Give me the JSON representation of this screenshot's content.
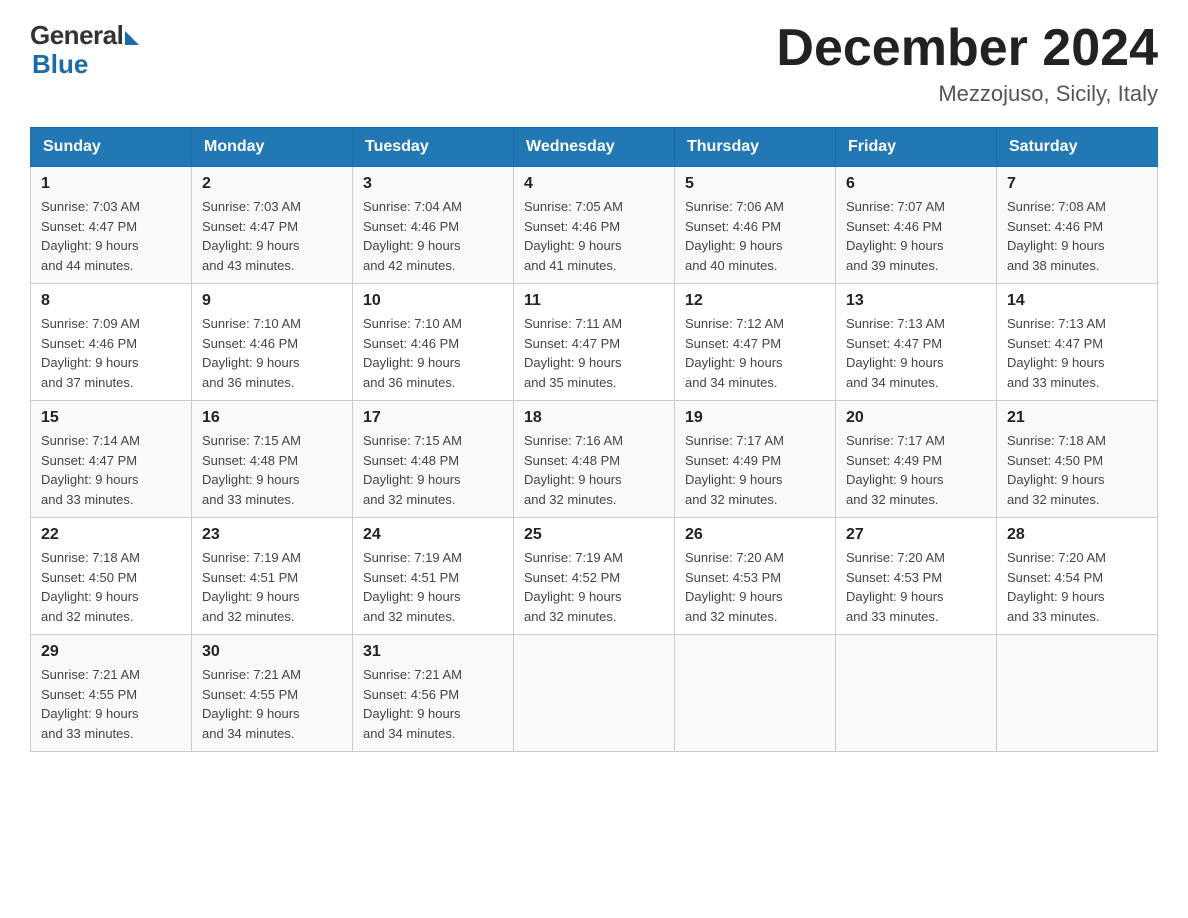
{
  "logo": {
    "general": "General",
    "blue": "Blue"
  },
  "header": {
    "title": "December 2024",
    "location": "Mezzojuso, Sicily, Italy"
  },
  "weekdays": [
    "Sunday",
    "Monday",
    "Tuesday",
    "Wednesday",
    "Thursday",
    "Friday",
    "Saturday"
  ],
  "weeks": [
    [
      {
        "day": "1",
        "sunrise": "7:03 AM",
        "sunset": "4:47 PM",
        "daylight": "9 hours and 44 minutes."
      },
      {
        "day": "2",
        "sunrise": "7:03 AM",
        "sunset": "4:47 PM",
        "daylight": "9 hours and 43 minutes."
      },
      {
        "day": "3",
        "sunrise": "7:04 AM",
        "sunset": "4:46 PM",
        "daylight": "9 hours and 42 minutes."
      },
      {
        "day": "4",
        "sunrise": "7:05 AM",
        "sunset": "4:46 PM",
        "daylight": "9 hours and 41 minutes."
      },
      {
        "day": "5",
        "sunrise": "7:06 AM",
        "sunset": "4:46 PM",
        "daylight": "9 hours and 40 minutes."
      },
      {
        "day": "6",
        "sunrise": "7:07 AM",
        "sunset": "4:46 PM",
        "daylight": "9 hours and 39 minutes."
      },
      {
        "day": "7",
        "sunrise": "7:08 AM",
        "sunset": "4:46 PM",
        "daylight": "9 hours and 38 minutes."
      }
    ],
    [
      {
        "day": "8",
        "sunrise": "7:09 AM",
        "sunset": "4:46 PM",
        "daylight": "9 hours and 37 minutes."
      },
      {
        "day": "9",
        "sunrise": "7:10 AM",
        "sunset": "4:46 PM",
        "daylight": "9 hours and 36 minutes."
      },
      {
        "day": "10",
        "sunrise": "7:10 AM",
        "sunset": "4:46 PM",
        "daylight": "9 hours and 36 minutes."
      },
      {
        "day": "11",
        "sunrise": "7:11 AM",
        "sunset": "4:47 PM",
        "daylight": "9 hours and 35 minutes."
      },
      {
        "day": "12",
        "sunrise": "7:12 AM",
        "sunset": "4:47 PM",
        "daylight": "9 hours and 34 minutes."
      },
      {
        "day": "13",
        "sunrise": "7:13 AM",
        "sunset": "4:47 PM",
        "daylight": "9 hours and 34 minutes."
      },
      {
        "day": "14",
        "sunrise": "7:13 AM",
        "sunset": "4:47 PM",
        "daylight": "9 hours and 33 minutes."
      }
    ],
    [
      {
        "day": "15",
        "sunrise": "7:14 AM",
        "sunset": "4:47 PM",
        "daylight": "9 hours and 33 minutes."
      },
      {
        "day": "16",
        "sunrise": "7:15 AM",
        "sunset": "4:48 PM",
        "daylight": "9 hours and 33 minutes."
      },
      {
        "day": "17",
        "sunrise": "7:15 AM",
        "sunset": "4:48 PM",
        "daylight": "9 hours and 32 minutes."
      },
      {
        "day": "18",
        "sunrise": "7:16 AM",
        "sunset": "4:48 PM",
        "daylight": "9 hours and 32 minutes."
      },
      {
        "day": "19",
        "sunrise": "7:17 AM",
        "sunset": "4:49 PM",
        "daylight": "9 hours and 32 minutes."
      },
      {
        "day": "20",
        "sunrise": "7:17 AM",
        "sunset": "4:49 PM",
        "daylight": "9 hours and 32 minutes."
      },
      {
        "day": "21",
        "sunrise": "7:18 AM",
        "sunset": "4:50 PM",
        "daylight": "9 hours and 32 minutes."
      }
    ],
    [
      {
        "day": "22",
        "sunrise": "7:18 AM",
        "sunset": "4:50 PM",
        "daylight": "9 hours and 32 minutes."
      },
      {
        "day": "23",
        "sunrise": "7:19 AM",
        "sunset": "4:51 PM",
        "daylight": "9 hours and 32 minutes."
      },
      {
        "day": "24",
        "sunrise": "7:19 AM",
        "sunset": "4:51 PM",
        "daylight": "9 hours and 32 minutes."
      },
      {
        "day": "25",
        "sunrise": "7:19 AM",
        "sunset": "4:52 PM",
        "daylight": "9 hours and 32 minutes."
      },
      {
        "day": "26",
        "sunrise": "7:20 AM",
        "sunset": "4:53 PM",
        "daylight": "9 hours and 32 minutes."
      },
      {
        "day": "27",
        "sunrise": "7:20 AM",
        "sunset": "4:53 PM",
        "daylight": "9 hours and 33 minutes."
      },
      {
        "day": "28",
        "sunrise": "7:20 AM",
        "sunset": "4:54 PM",
        "daylight": "9 hours and 33 minutes."
      }
    ],
    [
      {
        "day": "29",
        "sunrise": "7:21 AM",
        "sunset": "4:55 PM",
        "daylight": "9 hours and 33 minutes."
      },
      {
        "day": "30",
        "sunrise": "7:21 AM",
        "sunset": "4:55 PM",
        "daylight": "9 hours and 34 minutes."
      },
      {
        "day": "31",
        "sunrise": "7:21 AM",
        "sunset": "4:56 PM",
        "daylight": "9 hours and 34 minutes."
      },
      null,
      null,
      null,
      null
    ]
  ],
  "labels": {
    "sunrise": "Sunrise:",
    "sunset": "Sunset:",
    "daylight": "Daylight:"
  }
}
